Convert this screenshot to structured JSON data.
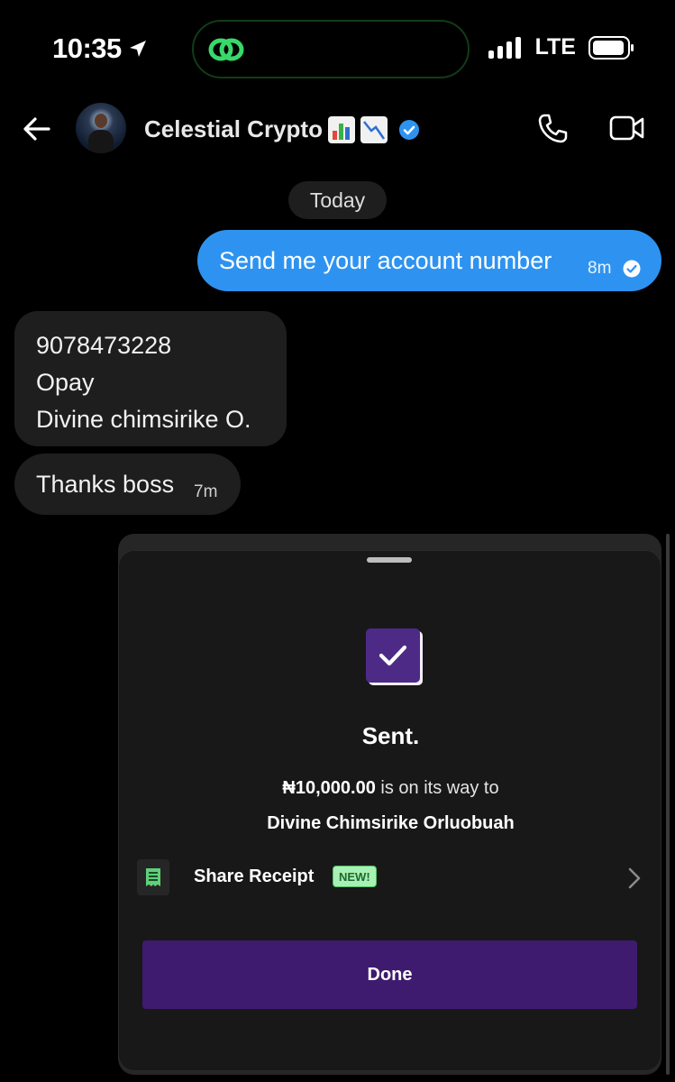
{
  "status_bar": {
    "time": "10:35",
    "network": "LTE"
  },
  "header": {
    "contact_name": "Celestial Crypto"
  },
  "conversation": {
    "date_label": "Today",
    "outgoing": {
      "text": "Send me your account number",
      "time": "8m"
    },
    "incoming": [
      {
        "lines": [
          "9078473228",
          "Opay",
          "Divine chimsirike O."
        ]
      },
      {
        "text": "Thanks boss",
        "time": "7m"
      }
    ]
  },
  "transfer_sheet": {
    "title": "Sent.",
    "amount": "₦10,000.00",
    "amount_suffix": "is on its way to",
    "recipient": "Divine Chimsirike Orluobuah",
    "share_label": "Share Receipt",
    "new_badge": "NEW!",
    "done_label": "Done"
  },
  "colors": {
    "sent_bubble": "#2e93f0",
    "received_bubble": "#1e1e1e",
    "accent_purple": "#3e1b6e",
    "check_purple": "#4d2a86",
    "new_badge_bg": "#a9f0b4",
    "verified_blue": "#2e93f0"
  },
  "icons": [
    "location-arrow-icon",
    "link-icon",
    "signal-icon",
    "battery-icon",
    "back-arrow-icon",
    "bar-chart-emoji",
    "chart-decreasing-emoji",
    "verified-icon",
    "phone-icon",
    "video-icon",
    "read-check-icon",
    "checkmark-icon",
    "receipt-icon",
    "chevron-right-icon"
  ]
}
